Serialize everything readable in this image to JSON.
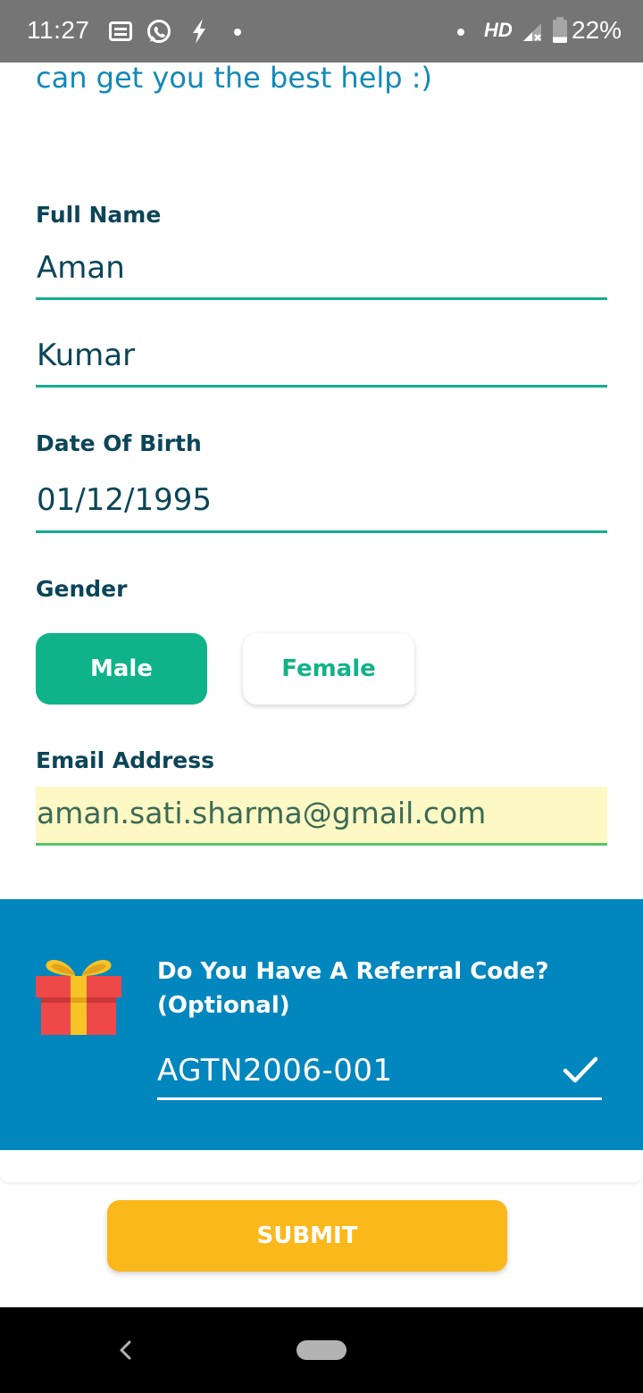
{
  "status_bar": {
    "time": "11:27",
    "network_label": "HD",
    "battery": "22%",
    "icons": [
      "message-icon",
      "whatsapp-icon",
      "bolt-icon",
      "dot-icon",
      "signal-icon",
      "battery-icon"
    ]
  },
  "intro_text": "can get you the best help :)",
  "form": {
    "full_name_label": "Full Name",
    "first_name": "Aman",
    "last_name": "Kumar",
    "dob_label": "Date Of Birth",
    "dob": "01/12/1995",
    "gender_label": "Gender",
    "gender_options": [
      "Male",
      "Female"
    ],
    "gender_selected": "Male",
    "email_label": "Email Address",
    "email": "aman.sati.sharma@gmail.com"
  },
  "referral": {
    "question": "Do You Have A Referral Code? (Optional)",
    "code": "AGTN2006-001"
  },
  "submit_label": "SUBMIT",
  "colors": {
    "primary_green": "#10b389",
    "accent_blue": "#0286be",
    "submit_yellow": "#fbb81b",
    "text_dark": "#0b4558",
    "email_highlight": "#fdf8c4"
  }
}
